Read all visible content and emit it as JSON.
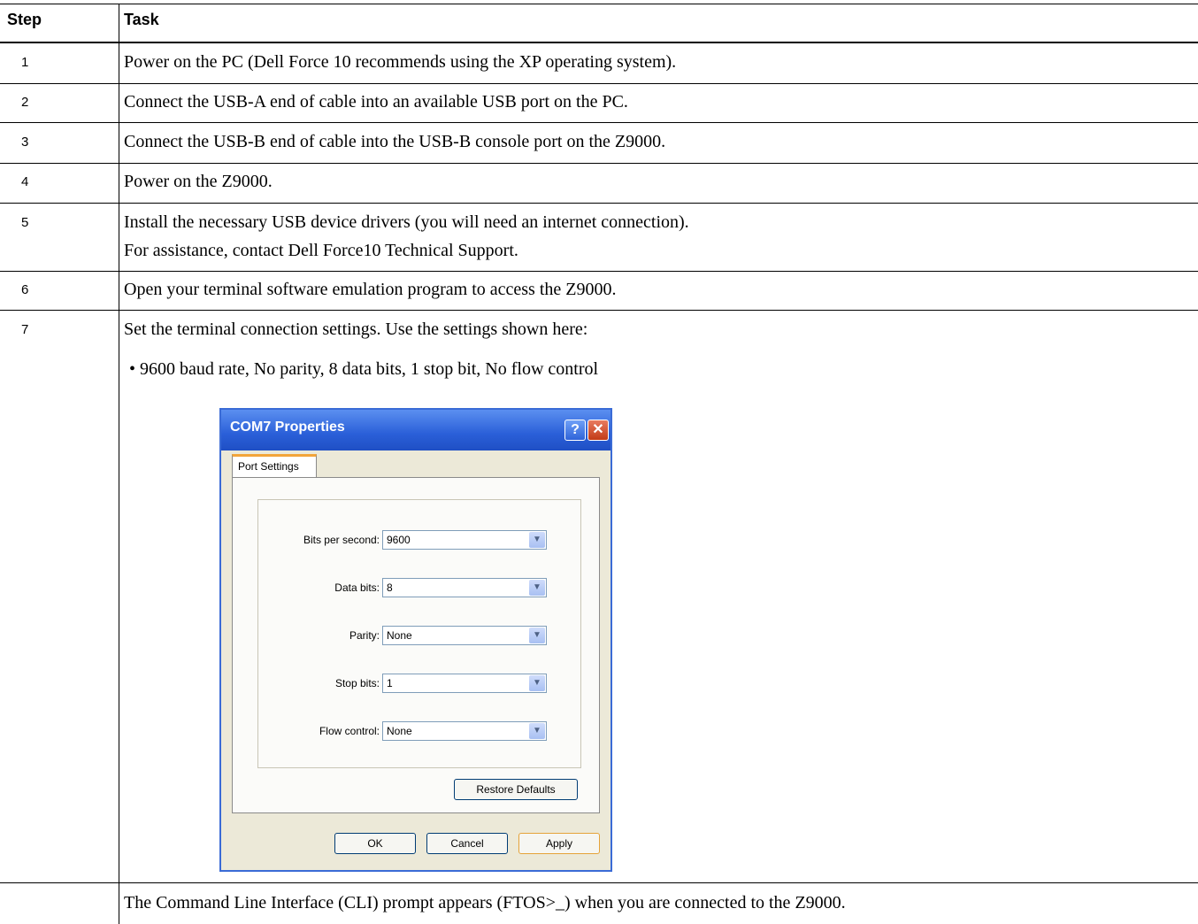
{
  "table": {
    "headers": {
      "step": "Step",
      "task": "Task"
    },
    "rows": [
      {
        "step": "1",
        "lines": [
          "Power on the PC (Dell Force 10 recommends using the XP operating system)."
        ]
      },
      {
        "step": "2",
        "lines": [
          "Connect the USB-A end of cable into an available USB port on the PC."
        ]
      },
      {
        "step": "3",
        "lines": [
          "Connect the USB-B end of cable into the USB-B console port on the Z9000."
        ]
      },
      {
        "step": "4",
        "lines": [
          "Power on the Z9000."
        ]
      },
      {
        "step": "5",
        "lines": [
          "Install the necessary USB device drivers (you will need an internet connection).",
          "For assistance, contact Dell Force10 Technical Support."
        ]
      },
      {
        "step": "6",
        "lines": [
          "Open your terminal software emulation program to access the Z9000."
        ]
      },
      {
        "step": "7",
        "lines": [
          "Set the terminal connection settings. Use the settings shown here:",
          "• 9600 baud rate, No parity, 8 data bits, 1 stop bit, No flow control"
        ]
      },
      {
        "step": "",
        "lines": [
          "The Command Line Interface (CLI) prompt appears (FTOS>_) when you are connected to the Z9000."
        ]
      }
    ]
  },
  "dialog": {
    "title": "COM7 Properties",
    "help_glyph": "?",
    "close_glyph": "✕",
    "tab": "Port Settings",
    "fields": [
      {
        "label": "Bits per second:",
        "value": "9600"
      },
      {
        "label": "Data bits:",
        "value": "8"
      },
      {
        "label": "Parity:",
        "value": "None"
      },
      {
        "label": "Stop bits:",
        "value": "1"
      },
      {
        "label": "Flow control:",
        "value": "None"
      }
    ],
    "dropdown_glyph": "▼",
    "restore_label": "Restore Defaults",
    "ok_label": "OK",
    "cancel_label": "Cancel",
    "apply_label": "Apply"
  }
}
